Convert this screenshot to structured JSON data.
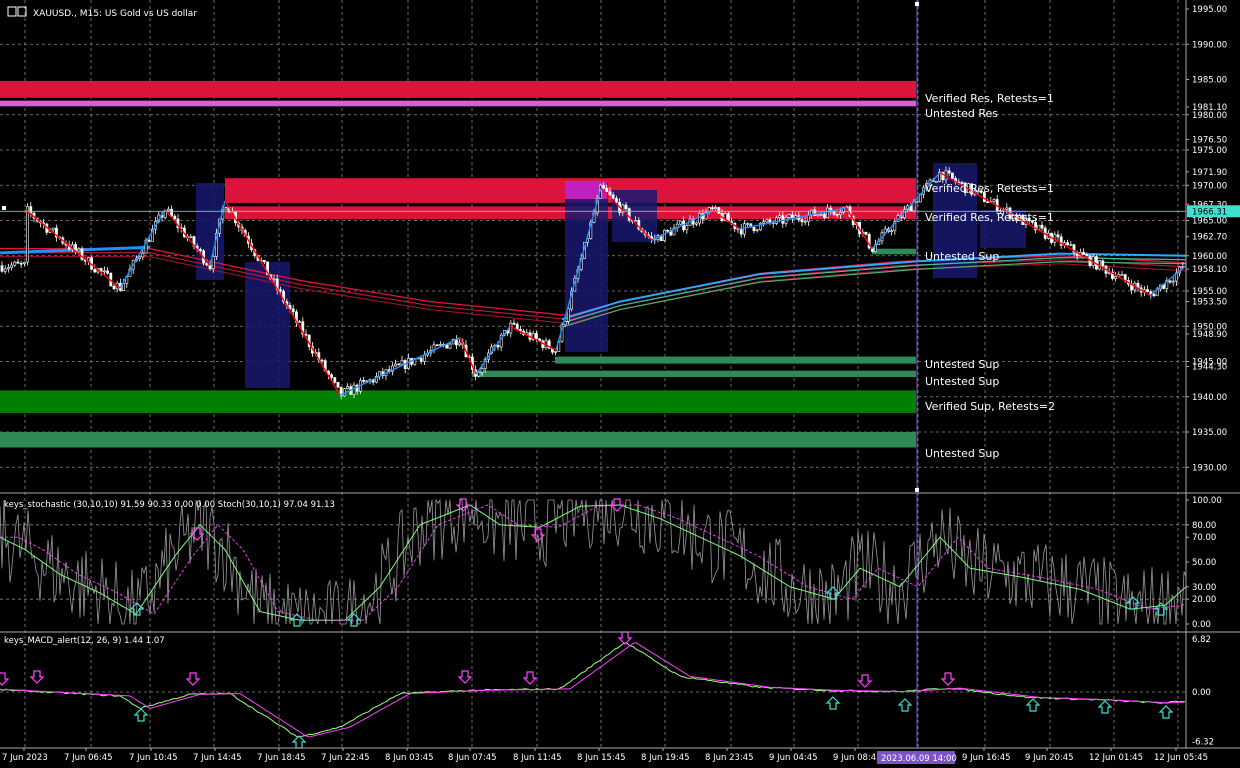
{
  "symbol_label": "XAUUSD., M15:  US Gold vs US dollar",
  "main_pane": {
    "price_axis_ticks": [
      "1995.00",
      "1990.00",
      "1985.00",
      "1981.10",
      "1980.00",
      "1976.50",
      "1975.00",
      "1971.90",
      "1970.00",
      "1967.30",
      "1965.00",
      "1962.70",
      "1960.00",
      "1958.10",
      "1955.00",
      "1953.50",
      "1950.00",
      "1948.90",
      "1945.00",
      "1944.30",
      "1940.00",
      "1935.00",
      "1930.00"
    ],
    "current_price": "1966.31",
    "zone_labels": [
      "Verified Res, Retests=1",
      "Untested Res",
      "Verified Res, Retests=1",
      "Verified Res, Retests=1",
      "Untested Sup",
      "Untested Sup",
      "Untested Sup",
      "Verified Sup, Retests=2",
      "Untested Sup"
    ]
  },
  "stoch_pane": {
    "label": "keys_stochastic (30,10,10) 91.59 90.33 0.00 0.00 Stoch(30,10,1) 97.04 91.13",
    "ticks": [
      "100.00",
      "80.00",
      "70.00",
      "50.00",
      "30.00",
      "20.00",
      "0.00"
    ]
  },
  "macd_pane": {
    "label": "keys_MACD_alert(12, 26, 9) 1.44 1.07",
    "ticks": [
      "6.82",
      "0.00",
      "-6.32"
    ]
  },
  "time_axis": {
    "labels": [
      "7 Jun 2023",
      "7 Jun 06:45",
      "7 Jun 10:45",
      "7 Jun 14:45",
      "7 Jun 18:45",
      "7 Jun 22:45",
      "8 Jun 03:45",
      "8 Jun 07:45",
      "8 Jun 11:45",
      "8 Jun 15:45",
      "8 Jun 19:45",
      "8 Jun 23:45",
      "9 Jun 04:45",
      "9 Jun 08:45",
      "9 Jun 16:45",
      "9 Jun 20:45",
      "12 Jun 01:45",
      "12 Jun 05:45"
    ],
    "cursor_label": "2023.06.09 14:00"
  },
  "chart_data": {
    "type": "candlestick",
    "symbol": "XAUUSD.",
    "timeframe": "M15",
    "title": "XAUUSD., M15:  US Gold vs US dollar",
    "ylim": [
      1927.5,
      1996.5
    ],
    "current_price": 1966.31,
    "zones": [
      {
        "label": "Verified Res, Retests=1",
        "low": 1982.4,
        "high": 1984.8,
        "color": "#dc143c"
      },
      {
        "label": "Untested Res",
        "low": 1981.2,
        "high": 1982.0,
        "color": "#d85fd0"
      },
      {
        "label": "Verified Res, Retests=1",
        "low": 1967.5,
        "high": 1971.0,
        "color": "#dc143c"
      },
      {
        "label": "Verified Res, Retests=1",
        "low": 1965.2,
        "high": 1967.0,
        "color": "#dc143c"
      },
      {
        "label": "Untested Sup",
        "low": 1960.2,
        "high": 1961.0,
        "color": "#2e8b57"
      },
      {
        "label": "Untested Sup",
        "low": 1944.7,
        "high": 1945.7,
        "color": "#2e8b57"
      },
      {
        "label": "Untested Sup",
        "low": 1942.8,
        "high": 1943.7,
        "color": "#2e8b57"
      },
      {
        "label": "Verified Sup, Retests=2",
        "low": 1937.7,
        "high": 1940.9,
        "color": "#008000"
      },
      {
        "label": "Untested Sup",
        "low": 1932.8,
        "high": 1935.0,
        "color": "#2e8b57"
      }
    ],
    "zigzag": [
      1966.6,
      1955.4,
      1966.6,
      1958.6,
      1967.8,
      1940.2,
      1948.4,
      1943.2,
      1950.0,
      1946.6,
      1969.6,
      1962.2,
      1966.4,
      1963.8,
      1966.8,
      1961.0,
      1971.8,
      1954.4,
      1958.6
    ]
  },
  "colors": {
    "background": "#000000",
    "candle": "#ffffff",
    "res_zone": "#dc143c",
    "untested_res": "#d85fd0",
    "sup_zone": "#008000",
    "untested_sup": "#2e8b57",
    "zigzag_up": "#1e90ff",
    "zigzag_down": "#ff0000",
    "box": "#191970",
    "cursor_line": "#7b52c8",
    "current_price_line": "#40e0d0"
  }
}
